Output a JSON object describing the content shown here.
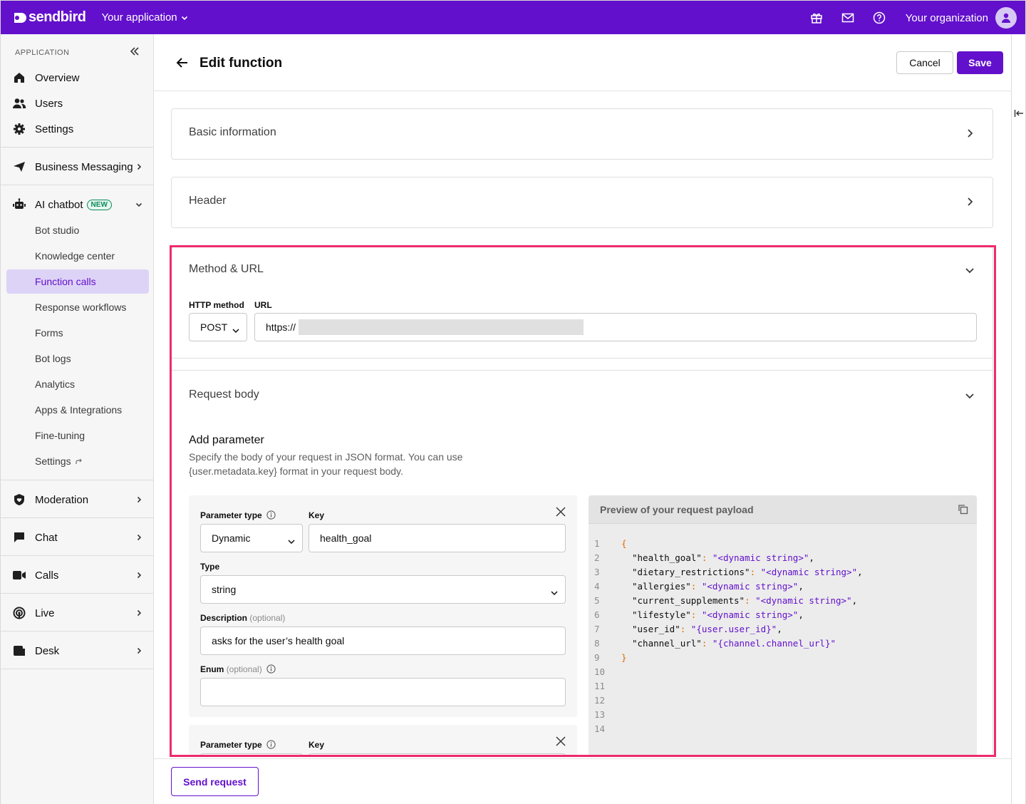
{
  "topbar": {
    "brand": "sendbird",
    "app_name": "Your application",
    "org_name": "Your organization",
    "icons": [
      "gift-icon",
      "mail-icon",
      "help-icon",
      "user-avatar-icon"
    ]
  },
  "sidebar": {
    "section_label": "APPLICATION",
    "primary": [
      {
        "label": "Overview",
        "icon": "home-icon"
      },
      {
        "label": "Users",
        "icon": "users-icon"
      },
      {
        "label": "Settings",
        "icon": "gear-icon"
      }
    ],
    "business_messaging": "Business Messaging",
    "ai_chatbot": "AI chatbot",
    "new_badge": "NEW",
    "ai_sub": [
      "Bot studio",
      "Knowledge center",
      "Function calls",
      "Response workflows",
      "Forms",
      "Bot logs",
      "Analytics",
      "Apps & Integrations",
      "Fine-tuning",
      "Settings"
    ],
    "active_sub": "Function calls",
    "groups": [
      "Moderation",
      "Chat",
      "Calls",
      "Live",
      "Desk"
    ]
  },
  "page": {
    "title": "Edit function",
    "cancel": "Cancel",
    "save": "Save"
  },
  "sections": {
    "basic": "Basic information",
    "header": "Header",
    "method_url": "Method & URL",
    "request_body": "Request body"
  },
  "method_url": {
    "method_label": "HTTP method",
    "method_value": "POST",
    "url_label": "URL",
    "url_value": "https://"
  },
  "request_body": {
    "add_title": "Add parameter",
    "desc_line1": "Specify the body of your request in JSON format. You can use",
    "desc_line2": "{user.metadata.key} format in your request body.",
    "param1": {
      "type_label": "Parameter type",
      "type_value": "Dynamic",
      "key_label": "Key",
      "key_value": "health_goal",
      "vtype_label": "Type",
      "vtype_value": "string",
      "desc_label": "Description",
      "desc_optional": "(optional)",
      "desc_value": "asks for the user’s health goal",
      "enum_label": "Enum",
      "enum_optional": "(optional)",
      "enum_value": ""
    },
    "param2": {
      "type_label": "Parameter type",
      "key_label": "Key"
    }
  },
  "preview": {
    "title": "Preview of your request payload",
    "lines": [
      {
        "n": "1",
        "key": "",
        "val": "",
        "pre": "{",
        "post": ""
      },
      {
        "n": "2",
        "key": "\"health_goal\"",
        "val": "\"<dynamic string>\"",
        "pre": "",
        "post": ","
      },
      {
        "n": "3",
        "key": "\"dietary_restrictions\"",
        "val": "\"<dynamic string>\"",
        "pre": "",
        "post": ","
      },
      {
        "n": "4",
        "key": "\"allergies\"",
        "val": "\"<dynamic string>\"",
        "pre": "",
        "post": ","
      },
      {
        "n": "5",
        "key": "\"current_supplements\"",
        "val": "\"<dynamic string>\"",
        "pre": "",
        "post": ","
      },
      {
        "n": "6",
        "key": "\"lifestyle\"",
        "val": "\"<dynamic string>\"",
        "pre": "",
        "post": ","
      },
      {
        "n": "7",
        "key": "\"user_id\"",
        "val": "\"{user.user_id}\"",
        "pre": "",
        "post": ","
      },
      {
        "n": "8",
        "key": "\"channel_url\"",
        "val": "\"{channel.channel_url}\"",
        "pre": "",
        "post": ""
      },
      {
        "n": "9",
        "key": "",
        "val": "",
        "pre": "}",
        "post": ""
      },
      {
        "n": "10",
        "key": "",
        "val": "",
        "pre": "",
        "post": ""
      },
      {
        "n": "11",
        "key": "",
        "val": "",
        "pre": "",
        "post": ""
      },
      {
        "n": "12",
        "key": "",
        "val": "",
        "pre": "",
        "post": ""
      },
      {
        "n": "13",
        "key": "",
        "val": "",
        "pre": "",
        "post": ""
      },
      {
        "n": "14",
        "key": "",
        "val": "",
        "pre": "",
        "post": ""
      }
    ]
  },
  "footer": {
    "send": "Send request"
  },
  "colors": {
    "brand": "#6210cc",
    "highlight": "#ee2b6b",
    "active_bg": "#ddd3f7",
    "new_badge": "#0a8a5a"
  }
}
